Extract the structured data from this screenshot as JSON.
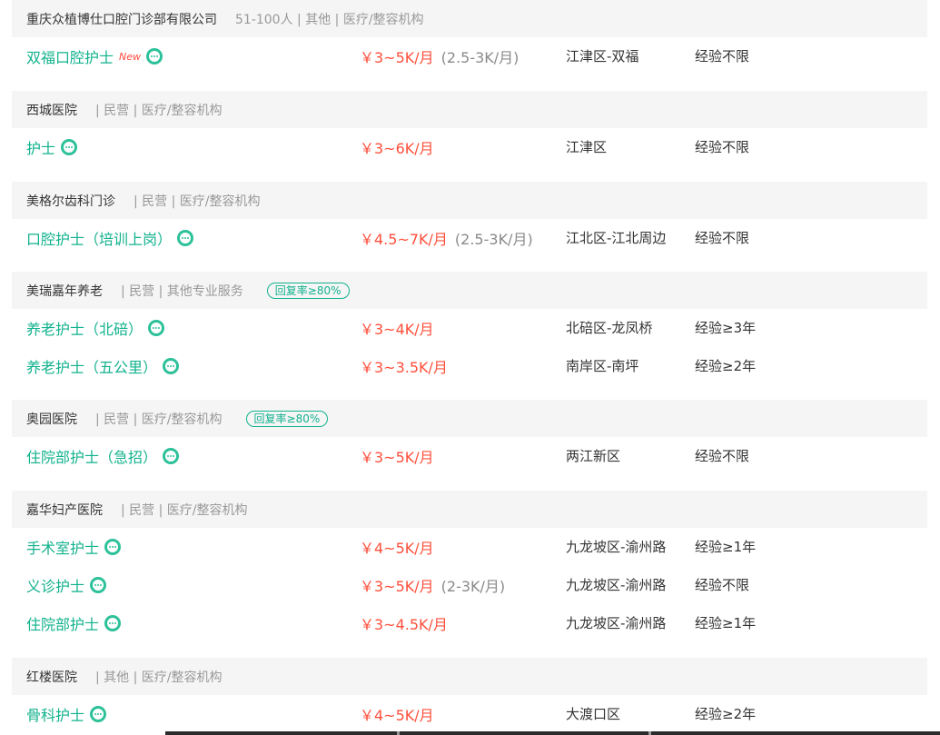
{
  "groups": [
    {
      "company": "重庆众植博仕口腔门诊部有限公司",
      "meta": "51-100人 | 其他 | 医疗/整容机构",
      "reply_badge": "",
      "jobs": [
        {
          "title": "双福口腔护士",
          "is_new": true,
          "new_label": "New",
          "salary": "￥3~5K/月",
          "salary_note": "(2.5-3K/月)",
          "location": "江津区-双福",
          "experience": "经验不限"
        }
      ]
    },
    {
      "company": "西城医院",
      "meta": "| 民营 | 医疗/整容机构",
      "reply_badge": "",
      "jobs": [
        {
          "title": "护士",
          "is_new": false,
          "new_label": "",
          "salary": "￥3~6K/月",
          "salary_note": "",
          "location": "江津区",
          "experience": "经验不限"
        }
      ]
    },
    {
      "company": "美格尔齿科门诊",
      "meta": "| 民营 | 医疗/整容机构",
      "reply_badge": "",
      "jobs": [
        {
          "title": "口腔护士（培训上岗）",
          "is_new": false,
          "new_label": "",
          "salary": "￥4.5~7K/月",
          "salary_note": "(2.5-3K/月)",
          "location": "江北区-江北周边",
          "experience": "经验不限"
        }
      ]
    },
    {
      "company": "美瑞嘉年养老",
      "meta": "| 民营 | 其他专业服务",
      "reply_badge": "回复率≥80%",
      "jobs": [
        {
          "title": "养老护士（北碚）",
          "is_new": false,
          "new_label": "",
          "salary": "￥3~4K/月",
          "salary_note": "",
          "location": "北碚区-龙凤桥",
          "experience": "经验≥3年"
        },
        {
          "title": "养老护士（五公里）",
          "is_new": false,
          "new_label": "",
          "salary": "￥3~3.5K/月",
          "salary_note": "",
          "location": "南岸区-南坪",
          "experience": "经验≥2年"
        }
      ]
    },
    {
      "company": "奥园医院",
      "meta": "| 民营 | 医疗/整容机构",
      "reply_badge": "回复率≥80%",
      "jobs": [
        {
          "title": "住院部护士（急招）",
          "is_new": false,
          "new_label": "",
          "salary": "￥3~5K/月",
          "salary_note": "",
          "location": "两江新区",
          "experience": "经验不限"
        }
      ]
    },
    {
      "company": "嘉华妇产医院",
      "meta": "| 民营 | 医疗/整容机构",
      "reply_badge": "",
      "jobs": [
        {
          "title": "手术室护士",
          "is_new": false,
          "new_label": "",
          "salary": "￥4~5K/月",
          "salary_note": "",
          "location": "九龙坡区-渝州路",
          "experience": "经验≥1年"
        },
        {
          "title": "义诊护士",
          "is_new": false,
          "new_label": "",
          "salary": "￥3~5K/月",
          "salary_note": "(2-3K/月)",
          "location": "九龙坡区-渝州路",
          "experience": "经验不限"
        },
        {
          "title": "住院部护士",
          "is_new": false,
          "new_label": "",
          "salary": "￥3~4.5K/月",
          "salary_note": "",
          "location": "九龙坡区-渝州路",
          "experience": "经验≥1年"
        }
      ]
    },
    {
      "company": "红楼医院",
      "meta": "| 其他 | 医疗/整容机构",
      "reply_badge": "",
      "jobs": [
        {
          "title": "骨科护士",
          "is_new": false,
          "new_label": "",
          "salary": "￥4~5K/月",
          "salary_note": "",
          "location": "大渡口区",
          "experience": "经验≥2年"
        }
      ]
    }
  ],
  "colors": {
    "accent": "#12b28d",
    "salary": "#ff4f3b",
    "header_bg": "#f5f5f6",
    "page_bg": "#ececec"
  },
  "icons": {
    "chat": "chat-bubble-icon"
  }
}
